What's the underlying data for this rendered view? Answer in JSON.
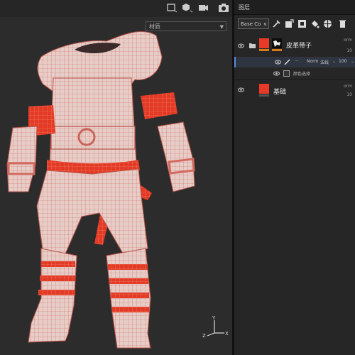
{
  "viewport": {
    "material_dropdown": {
      "value": "材质"
    },
    "axis_labels": {
      "y": "Y",
      "x": "X",
      "z": "Z"
    }
  },
  "panel": {
    "title": "图层",
    "channel_select": "Base Co",
    "layers": [
      {
        "name": "皮革带子",
        "blend": "orm",
        "opacity": "10"
      },
      {
        "name": "基础",
        "blend": "orm",
        "opacity": "10"
      }
    ],
    "sublayers": [
      {
        "dots": "···",
        "blend_mode": "Norm",
        "channel": "法线",
        "opacity": "100"
      },
      {
        "name": "颜色选择"
      }
    ]
  },
  "colors": {
    "accent_red": "#e83a26",
    "mesh_base": "#e6c9c3",
    "panel_bg": "#262626"
  }
}
